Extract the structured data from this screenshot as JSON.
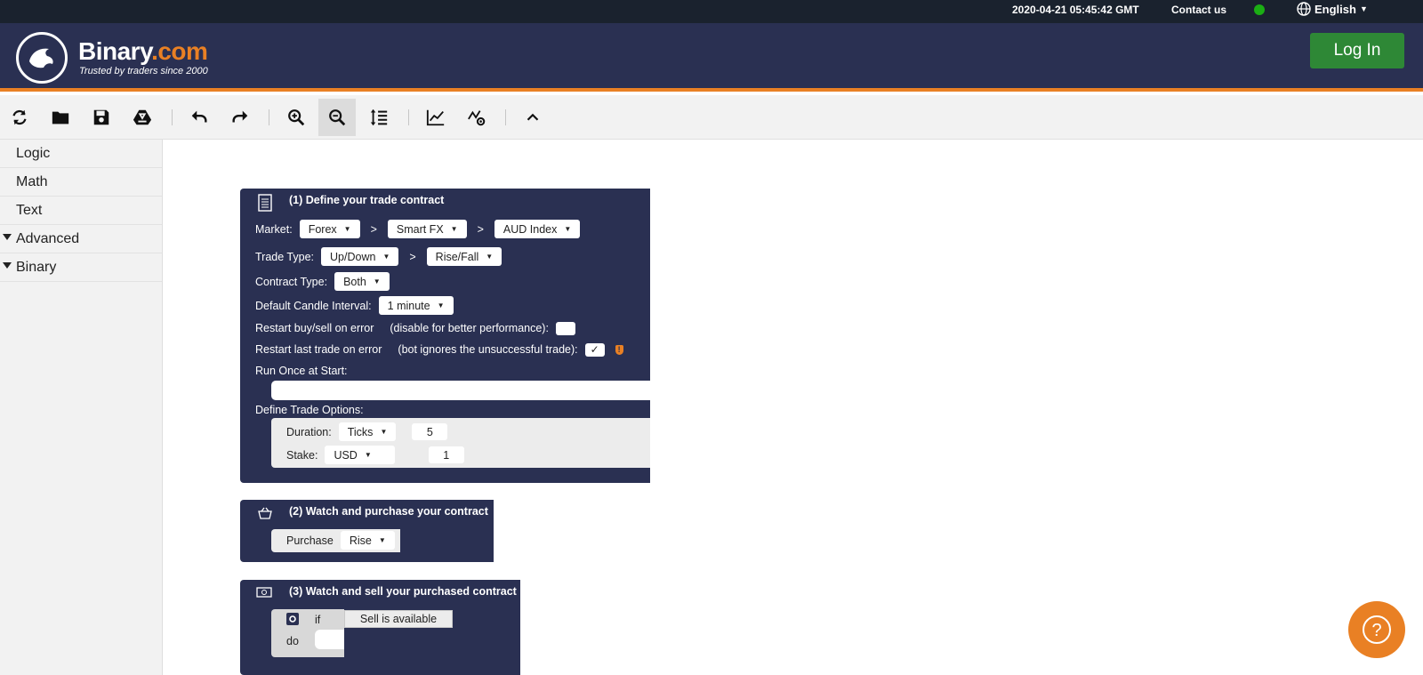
{
  "topbar": {
    "time": "2020-04-21 05:45:42 GMT",
    "contact": "Contact us",
    "language": "English"
  },
  "header": {
    "brand": "Binary",
    "brand_suffix": ".com",
    "tagline": "Trusted by traders since 2000",
    "login_label": "Log In"
  },
  "toolbar": {
    "buttons": [
      "reset-icon",
      "folder-icon",
      "save-icon",
      "google-drive-icon",
      "undo-icon",
      "redo-icon",
      "zoom-in-icon",
      "zoom-out-icon",
      "rearrange-icon",
      "chart-icon",
      "trading-view-icon",
      "collapse-icon"
    ]
  },
  "sidebar": {
    "items": [
      {
        "label": "Logic",
        "expandable": false
      },
      {
        "label": "Math",
        "expandable": false
      },
      {
        "label": "Text",
        "expandable": false
      },
      {
        "label": "Advanced",
        "expandable": true
      },
      {
        "label": "Binary",
        "expandable": true
      }
    ]
  },
  "blocks": {
    "trade_definition": {
      "title": "(1) Define your trade contract",
      "market_label": "Market:",
      "market": "Forex",
      "submarket": "Smart FX",
      "symbol": "AUD Index",
      "sep": ">",
      "trade_type_label": "Trade Type:",
      "trade_category": "Up/Down",
      "trade_type": "Rise/Fall",
      "contract_type_label": "Contract Type:",
      "contract_type": "Both",
      "candle_label": "Default Candle Interval:",
      "candle_interval": "1 minute",
      "restart_buy_label": "Restart buy/sell on error",
      "restart_buy_hint": "(disable for better performance):",
      "restart_last_label": "Restart last trade on error",
      "restart_last_hint": "(bot ignores the unsuccessful trade):",
      "restart_last_check": "✓",
      "warning": "!",
      "run_once_label": "Run Once at Start:",
      "trade_options_label": "Define Trade Options:",
      "duration_label": "Duration:",
      "duration_unit": "Ticks",
      "duration_value": "5",
      "stake_label": "Stake:",
      "currency": "USD",
      "stake_value": "1"
    },
    "purchase": {
      "title": "(2) Watch and purchase your contract",
      "purchase_label": "Purchase",
      "purchase_value": "Rise"
    },
    "sell": {
      "title": "(3) Watch and sell your purchased contract",
      "if_label": "if",
      "condition": "Sell is available",
      "do_label": "do"
    }
  },
  "help": {
    "icon": "question-icon",
    "label": "?"
  },
  "colors": {
    "header": "#2a3052",
    "accent": "#e98024",
    "login": "#2e8836",
    "block": "#2a3052"
  }
}
